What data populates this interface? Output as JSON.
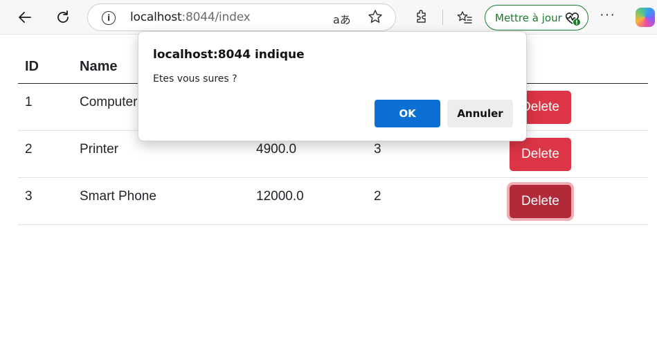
{
  "browser": {
    "url_host": "localhost",
    "url_rest": ":8044/index",
    "read_aloud_glyph": "aあ",
    "update_button_label": "Mettre à jour",
    "more_glyph": "···"
  },
  "table": {
    "headers": [
      "ID",
      "Name"
    ],
    "rows": [
      {
        "id": "1",
        "name": "Computer",
        "price": "",
        "quantity": "",
        "delete_label": "Delete"
      },
      {
        "id": "2",
        "name": "Printer",
        "price": "4900.0",
        "quantity": "3",
        "delete_label": "Delete"
      },
      {
        "id": "3",
        "name": "Smart Phone",
        "price": "12000.0",
        "quantity": "2",
        "delete_label": "Delete"
      }
    ]
  },
  "dialog": {
    "title": "localhost:8044 indique",
    "message": "Etes vous sures ?",
    "ok_label": "OK",
    "cancel_label": "Annuler"
  },
  "colors": {
    "danger": "#dc3545",
    "primary": "#0b6fd4",
    "update_green": "#1b7a2d"
  }
}
